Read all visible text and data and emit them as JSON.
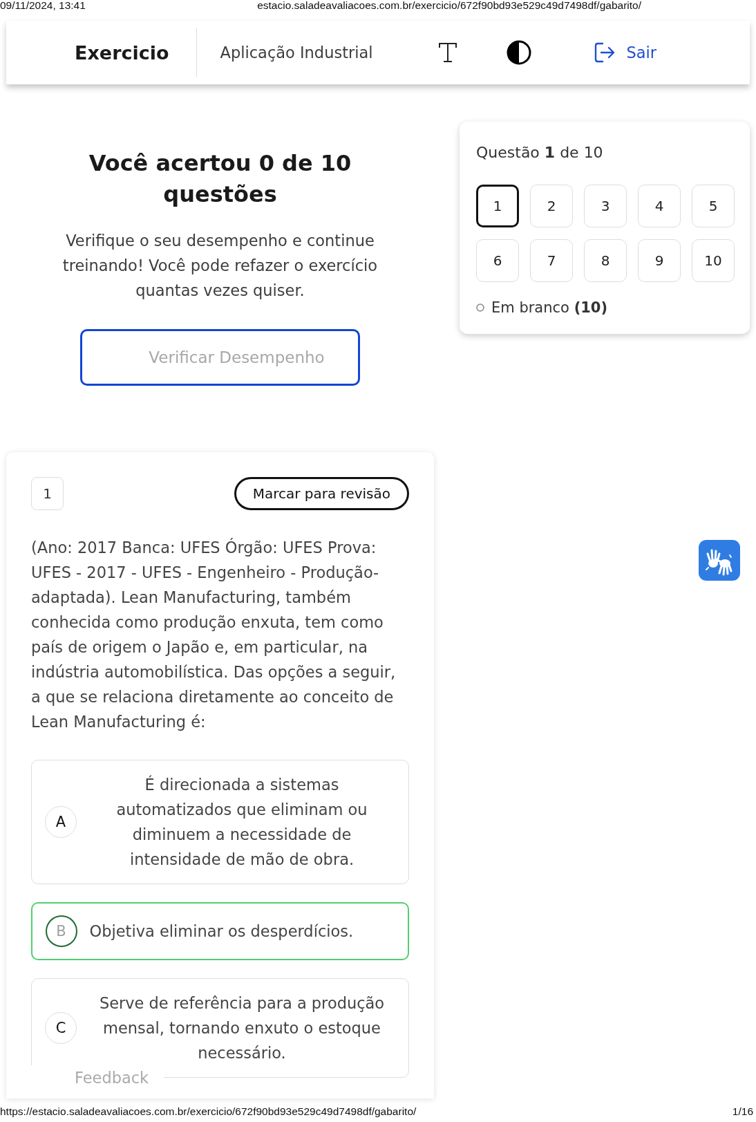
{
  "print_header": {
    "date_time": "09/11/2024, 13:41",
    "url": "estacio.saladeavaliacoes.com.br/exercicio/672f90bd93e529c49d7498df/gabarito/"
  },
  "navbar": {
    "title": "Exercicio",
    "subject": "Aplicação Industrial",
    "logout_label": "Sair"
  },
  "result": {
    "heading": "Você acertou 0 de 10 questões",
    "message": "Verifique o seu desempenho e continue treinando! Você pode refazer o exercício quantas vezes quiser.",
    "button": "Verificar Desempenho"
  },
  "navigator": {
    "counter": "Questão **1** de 10",
    "questions": [
      {
        "label": "1",
        "selected": true
      },
      {
        "label": "2",
        "selected": false
      },
      {
        "label": "3",
        "selected": false
      },
      {
        "label": "4",
        "selected": false
      },
      {
        "label": "5",
        "selected": false
      },
      {
        "label": "6",
        "selected": false
      },
      {
        "label": "7",
        "selected": false
      },
      {
        "label": "8",
        "selected": false
      },
      {
        "label": "9",
        "selected": false
      },
      {
        "label": "10",
        "selected": false
      }
    ],
    "legend": [
      {
        "kind": "blank",
        "text": "Em branco **(10)**"
      }
    ]
  },
  "question": {
    "number": "1",
    "review_button": "Marcar para revisão",
    "statement": "(Ano: 2017 Banca: UFES Órgão: UFES Prova: UFES - 2017 - UFES - Engenheiro - Produção-adaptada). Lean Manufacturing, também conhecida como produção enxuta, tem como país de origem o Japão e, em particular, na indústria automobilística. Das opções a seguir, a que se relaciona diretamente ao conceito de Lean Manufacturing é:",
    "options": [
      {
        "letter": "A",
        "text": "É direcionada a sistemas automatizados que eliminam ou diminuem a necessidade de intensidade de mão de obra.",
        "correct": false
      },
      {
        "letter": "B",
        "text": "Objetiva eliminar os desperdícios.",
        "correct": true
      },
      {
        "letter": "C",
        "text": "Serve de referência para a produção mensal, tornando enxuto o estoque necessário.",
        "correct": false
      }
    ],
    "feedback_label": "Feedback"
  },
  "print_footer": {
    "url": "https://estacio.saladeavaliacoes.com.br/exercicio/672f90bd93e529c49d7498df/gabarito/",
    "page": "1/16"
  }
}
